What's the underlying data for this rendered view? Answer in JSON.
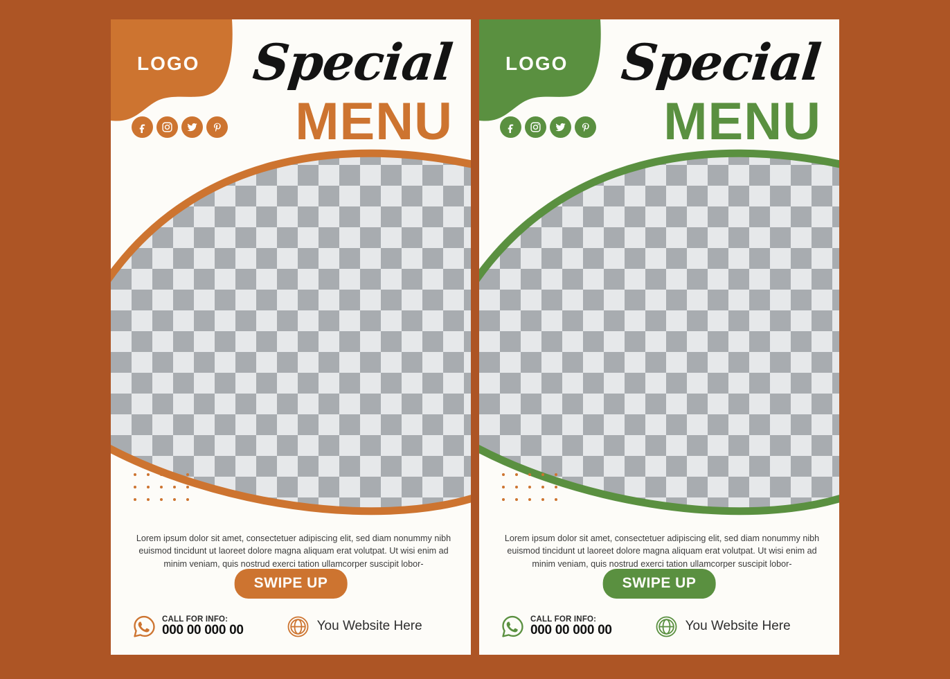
{
  "page": {
    "background_color": "#ad5525",
    "card_background": "#fdfcf8"
  },
  "colors": {
    "orange": "#cd7430",
    "green": "#5a9040",
    "page_bg": "#ad5525",
    "dot": "#cd7430",
    "checker_light": "#e6e8ea",
    "checker_dark": "#a8acb0",
    "text_dark": "#111111",
    "body_text": "#3b3b3b"
  },
  "cards": [
    {
      "variant": "orange",
      "accent": "#cd7430",
      "logo": "LOGO",
      "title_script": "Special",
      "title_bold": "MENU",
      "socials": [
        {
          "name": "facebook-icon",
          "label": "Facebook"
        },
        {
          "name": "instagram-icon",
          "label": "Instagram"
        },
        {
          "name": "twitter-icon",
          "label": "Twitter"
        },
        {
          "name": "pinterest-icon",
          "label": "Pinterest"
        }
      ],
      "body": "Lorem ipsum dolor sit amet, consectetuer adipiscing elit, sed diam nonummy nibh euismod tincidunt ut laoreet dolore magna aliquam erat volutpat. Ut wisi enim ad minim veniam, quis nostrud exerci tation ullamcorper suscipit lobor-",
      "cta": "SWIPE UP",
      "call_label": "CALL FOR INFO:",
      "call_number": "000 00 000 00",
      "website": "You Website Here"
    },
    {
      "variant": "green",
      "accent": "#5a9040",
      "logo": "LOGO",
      "title_script": "Special",
      "title_bold": "MENU",
      "socials": [
        {
          "name": "facebook-icon",
          "label": "Facebook"
        },
        {
          "name": "instagram-icon",
          "label": "Instagram"
        },
        {
          "name": "twitter-icon",
          "label": "Twitter"
        },
        {
          "name": "pinterest-icon",
          "label": "Pinterest"
        }
      ],
      "body": "Lorem ipsum dolor sit amet, consectetuer adipiscing elit, sed diam nonummy nibh euismod tincidunt ut laoreet dolore magna aliquam erat volutpat. Ut wisi enim ad minim veniam, quis nostrud exerci tation ullamcorper suscipit lobor-",
      "cta": "SWIPE UP",
      "call_label": "CALL FOR INFO:",
      "call_number": "000 00 000 00",
      "website": "You Website Here"
    }
  ]
}
